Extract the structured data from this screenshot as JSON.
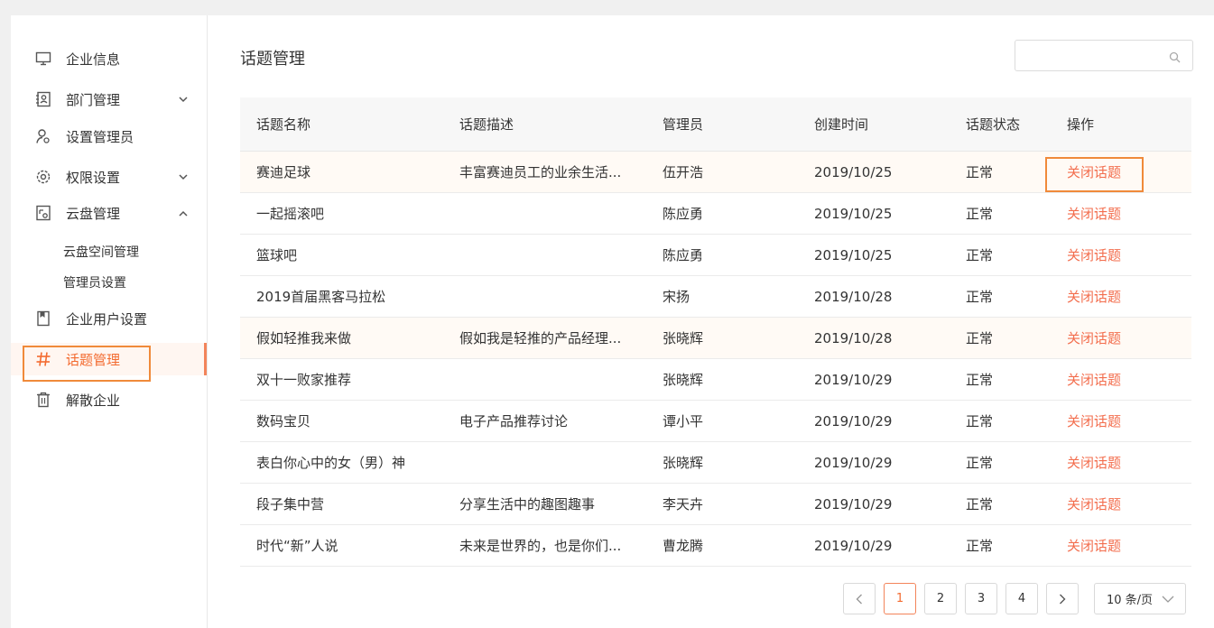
{
  "sidebar": {
    "items": [
      {
        "label": "企业信息"
      },
      {
        "label": "部门管理"
      },
      {
        "label": "设置管理员"
      },
      {
        "label": "权限设置"
      },
      {
        "label": "云盘管理"
      },
      {
        "label": "企业用户设置"
      },
      {
        "label": "话题管理"
      },
      {
        "label": "解散企业"
      }
    ],
    "subitems": [
      {
        "label": "云盘空间管理"
      },
      {
        "label": "管理员设置"
      }
    ]
  },
  "main": {
    "title": "话题管理",
    "search": {
      "value": "",
      "placeholder": ""
    }
  },
  "table": {
    "headers": [
      "话题名称",
      "话题描述",
      "管理员",
      "创建时间",
      "话题状态",
      "操作"
    ],
    "rows": [
      {
        "name": "赛迪足球",
        "desc": "丰富赛迪员工的业余生活...",
        "admin": "伍开浩",
        "date": "2019/10/25",
        "status": "正常",
        "op": "关闭话题"
      },
      {
        "name": "一起摇滚吧",
        "desc": "",
        "admin": "陈应勇",
        "date": "2019/10/25",
        "status": "正常",
        "op": "关闭话题"
      },
      {
        "name": "篮球吧",
        "desc": "",
        "admin": "陈应勇",
        "date": "2019/10/25",
        "status": "正常",
        "op": "关闭话题"
      },
      {
        "name": "2019首届黑客马拉松",
        "desc": "",
        "admin": "宋扬",
        "date": "2019/10/28",
        "status": "正常",
        "op": "关闭话题"
      },
      {
        "name": "假如轻推我来做",
        "desc": "假如我是轻推的产品经理...",
        "admin": "张晓辉",
        "date": "2019/10/28",
        "status": "正常",
        "op": "关闭话题"
      },
      {
        "name": "双十一败家推荐",
        "desc": "",
        "admin": "张晓辉",
        "date": "2019/10/29",
        "status": "正常",
        "op": "关闭话题"
      },
      {
        "name": "数码宝贝",
        "desc": "电子产品推荐讨论",
        "admin": "谭小平",
        "date": "2019/10/29",
        "status": "正常",
        "op": "关闭话题"
      },
      {
        "name": "表白你心中的女（男）神",
        "desc": "",
        "admin": "张晓辉",
        "date": "2019/10/29",
        "status": "正常",
        "op": "关闭话题"
      },
      {
        "name": "段子集中营",
        "desc": "分享生活中的趣图趣事",
        "admin": "李天卉",
        "date": "2019/10/29",
        "status": "正常",
        "op": "关闭话题"
      },
      {
        "name": "时代“新”人说",
        "desc": "未来是世界的，也是你们...",
        "admin": "曹龙腾",
        "date": "2019/10/29",
        "status": "正常",
        "op": "关闭话题"
      }
    ]
  },
  "pagination": {
    "pages": [
      "1",
      "2",
      "3",
      "4"
    ],
    "current": "1",
    "page_size": "10 条/页"
  },
  "colors": {
    "accent": "#f36e4e",
    "highlight_border": "#f08a3a"
  }
}
